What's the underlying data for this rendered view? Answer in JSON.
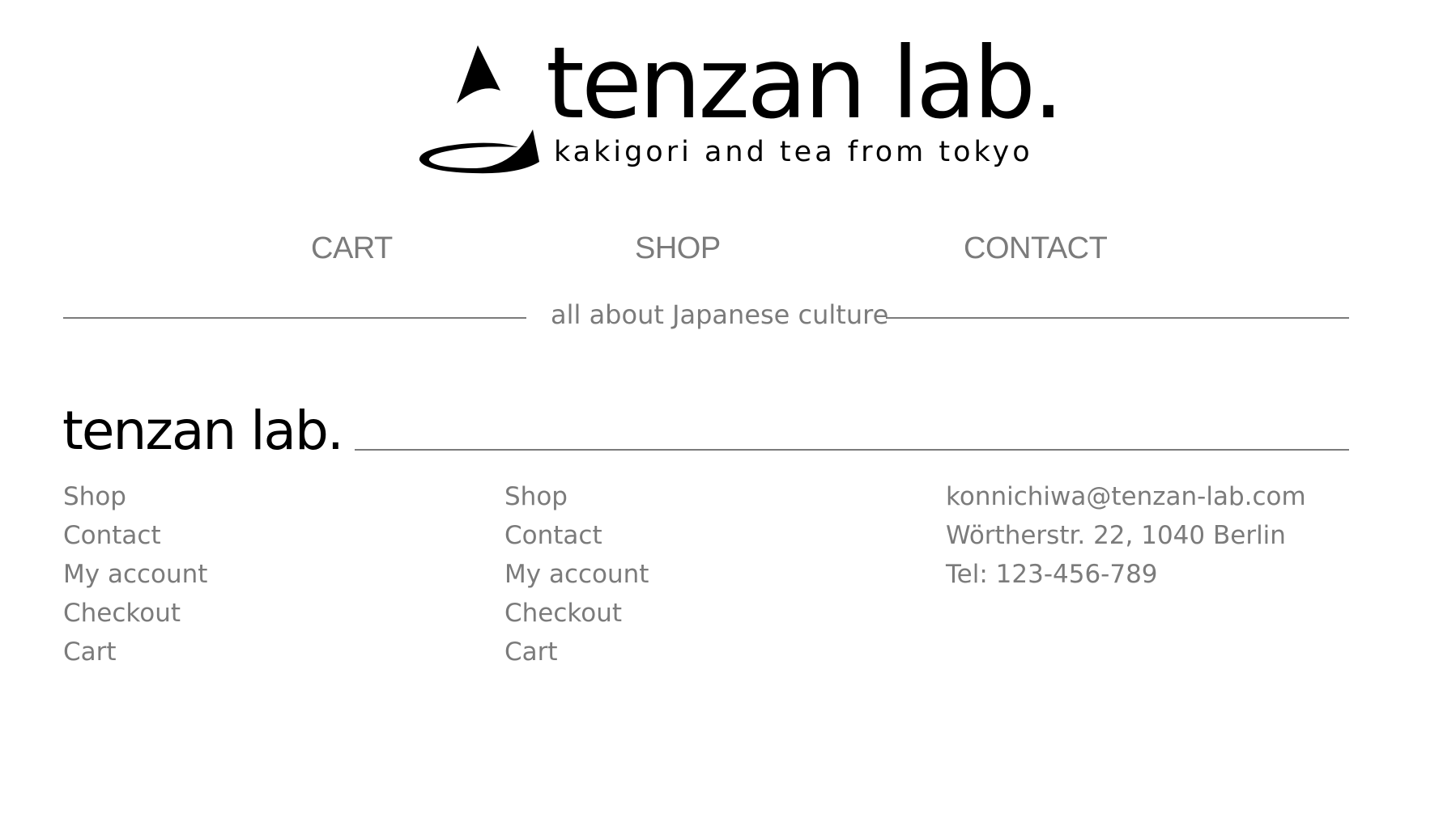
{
  "header": {
    "logo": {
      "wordmark": "tenzan lab.",
      "tagline": "kakigori and tea from tokyo",
      "icon": "kakigori-cone-logo-icon"
    }
  },
  "nav": {
    "items": [
      {
        "label": "CART"
      },
      {
        "label": "SHOP"
      },
      {
        "label": "CONTACT"
      }
    ]
  },
  "divider": {
    "text": "all about Japanese culture"
  },
  "footer": {
    "brand": "tenzan lab.",
    "columns": [
      {
        "links": [
          {
            "label": "Shop"
          },
          {
            "label": "Contact"
          },
          {
            "label": "My account"
          },
          {
            "label": "Checkout"
          },
          {
            "label": "Cart"
          }
        ]
      },
      {
        "links": [
          {
            "label": "Shop"
          },
          {
            "label": "Contact"
          },
          {
            "label": "My account"
          },
          {
            "label": "Checkout"
          },
          {
            "label": "Cart"
          }
        ]
      }
    ],
    "contact": {
      "email": "konnichiwa@tenzan-lab.com",
      "address": "Wörtherstr. 22, 1040 Berlin",
      "phone": "Tel: 123-456-789"
    }
  },
  "colors": {
    "text_primary": "#000000",
    "text_muted": "#7b7b7b",
    "background": "#ffffff"
  }
}
